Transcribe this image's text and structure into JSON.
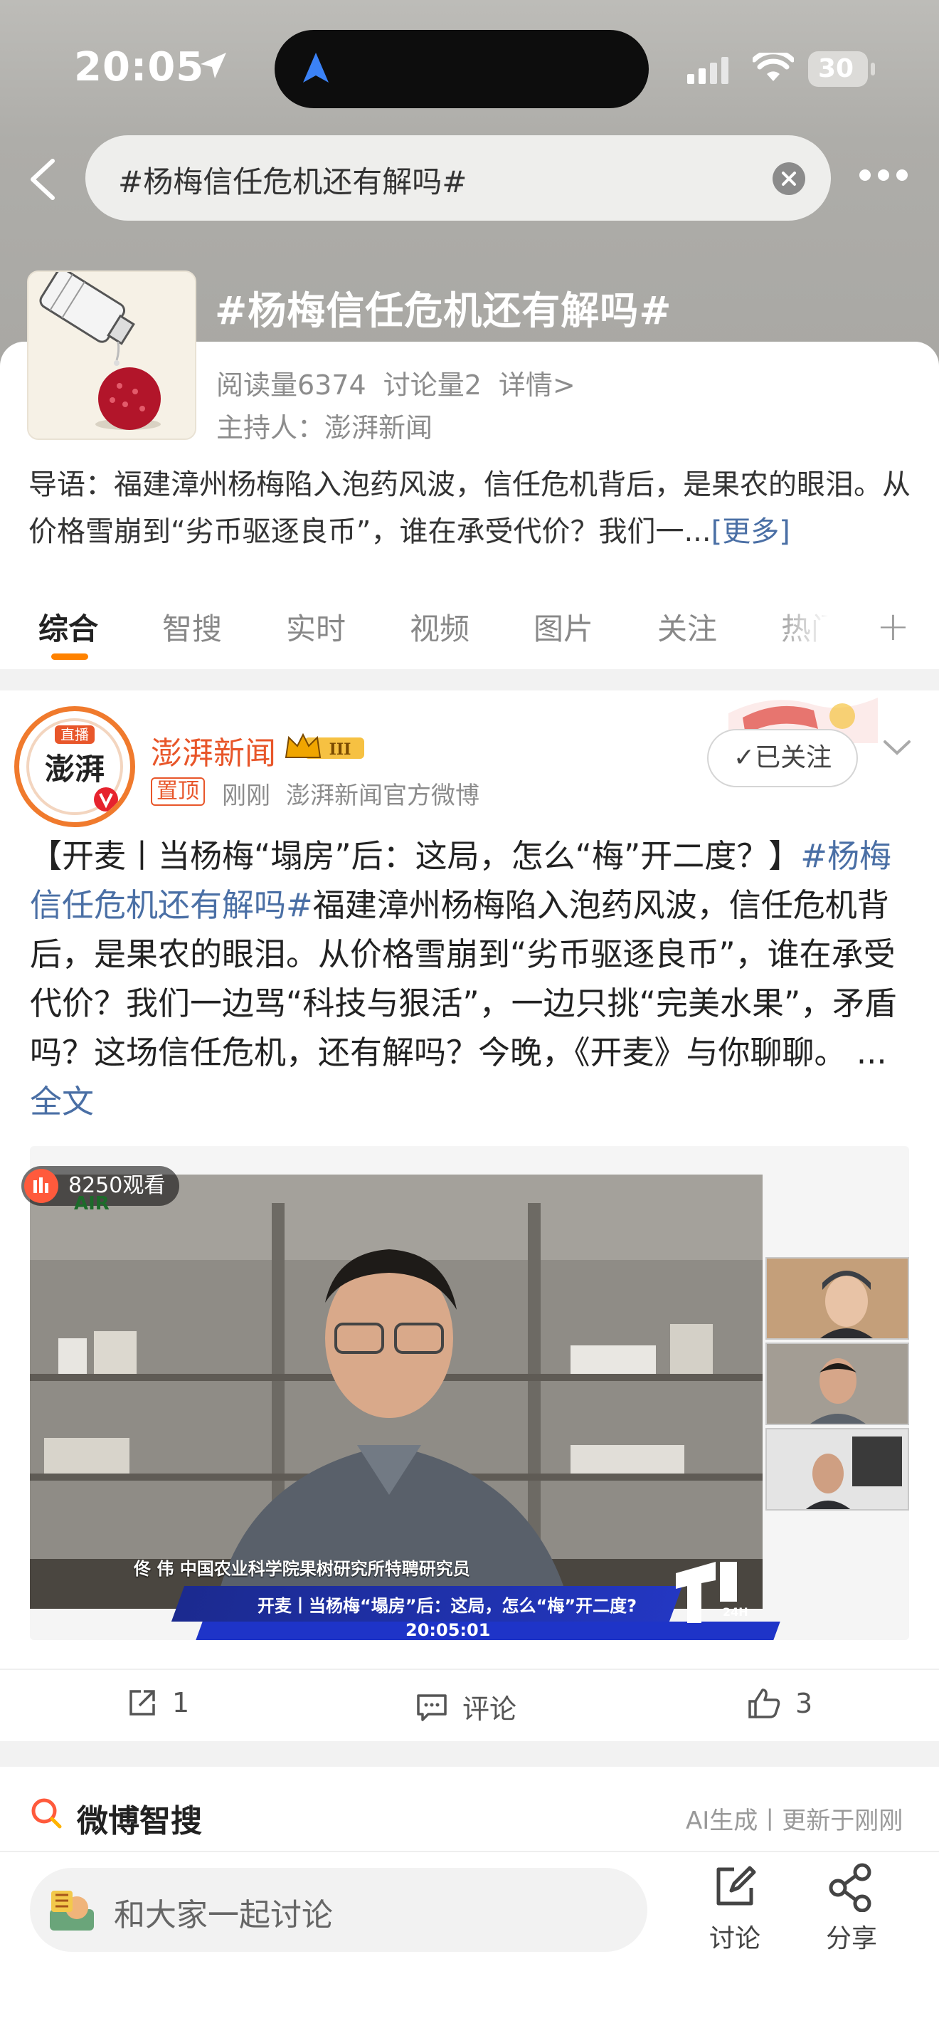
{
  "status_bar": {
    "time": "20:05",
    "battery": "30"
  },
  "search": {
    "query": "#杨梅信任危机还有解吗#"
  },
  "topic": {
    "title": "#杨梅信任危机还有解吗#",
    "reads": "阅读量6374",
    "discussions": "讨论量2",
    "details": "详情>",
    "host": "主持人：澎湃新闻",
    "intro": "导语：福建漳州杨梅陷入泡药风波，信任危机背后，是果农的眼泪。从价格雪崩到“劣币驱逐良币”，谁在承受代价？我们一...",
    "intro_more": "[更多]"
  },
  "tabs": [
    {
      "label": "综合",
      "active": true
    },
    {
      "label": "智搜",
      "active": false
    },
    {
      "label": "实时",
      "active": false
    },
    {
      "label": "视频",
      "active": false
    },
    {
      "label": "图片",
      "active": false
    },
    {
      "label": "关注",
      "active": false
    },
    {
      "label": "热门",
      "active": false
    }
  ],
  "post": {
    "avatar_text_top": "直播",
    "avatar_text_main": "澎湃",
    "author": "澎湃新闻",
    "level": "III",
    "pin": "置顶",
    "time": "刚刚",
    "source": "澎湃新闻官方微博",
    "follow_label": "✓已关注",
    "body_prefix": "【开麦丨当杨梅“塌房”后：这局，怎么“梅”开二度？】",
    "body_topic": "#杨梅信任危机还有解吗#",
    "body_rest": "福建漳州杨梅陷入泡药风波，信任危机背后，是果农的眼泪。从价格雪崩到“劣币驱逐良币”，谁在承受代价？我们一边骂“科技与狠活”，一边只挑“完美水果”，矛盾吗？这场信任危机，还有解吗？今晚，《开麦》与你聊聊。",
    "ellipsis": " ... ",
    "full_text": "全文",
    "video": {
      "viewers": "8250观看",
      "caption_name": "佟 伟  中国农业科学院果树研究所特聘研究员",
      "lower_third": "开麦丨当杨梅“塌房”后：这局，怎么“梅”开二度?",
      "clock": "20:05:01",
      "logo": "24H LIVE"
    },
    "actions": {
      "repost": "1",
      "comment": "评论",
      "like": "3"
    }
  },
  "ai_search": {
    "title": "微博智搜",
    "meta": "AI生成丨更新于刚刚"
  },
  "bottom": {
    "input_placeholder": "和大家一起讨论",
    "discuss": "讨论",
    "share": "分享"
  },
  "colors": {
    "accent": "#ff8200",
    "link": "#4a6fa5",
    "brand": "#e8562a"
  }
}
